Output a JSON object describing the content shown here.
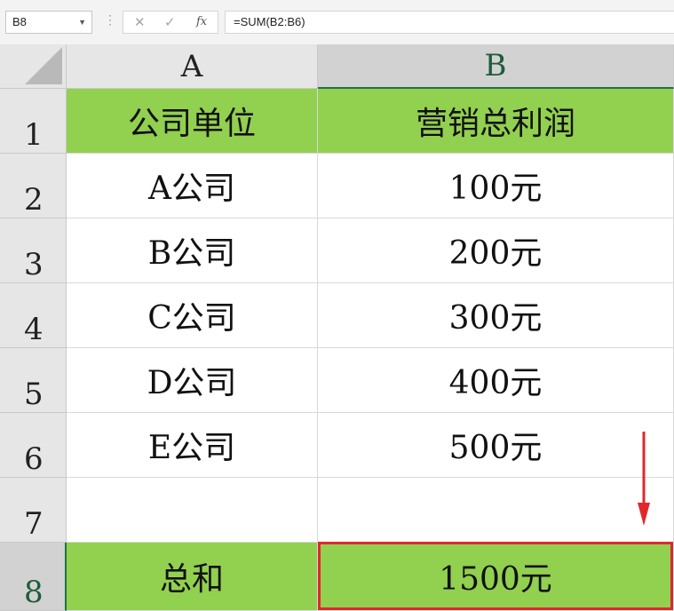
{
  "formula_bar": {
    "name_box": "B8",
    "cancel_icon": "✕",
    "enter_icon": "✓",
    "fx_label": "fx",
    "formula": "=SUM(B2:B6)"
  },
  "columns": [
    "A",
    "B"
  ],
  "rows": [
    "1",
    "2",
    "3",
    "4",
    "5",
    "6",
    "7",
    "8"
  ],
  "cells": {
    "A1": "公司单位",
    "B1": "营销总利润",
    "A2": "A公司",
    "B2": "100元",
    "A3": "B公司",
    "B3": "200元",
    "A4": "C公司",
    "B4": "300元",
    "A5": "D公司",
    "B5": "400元",
    "A6": "E公司",
    "B6": "500元",
    "A7": "",
    "B7": "",
    "A8": "总和",
    "B8": "1500元"
  },
  "colors": {
    "header_fill": "#92d050",
    "selection_highlight": "#e0282c",
    "arrow": "#e0282c",
    "selected_header_accent": "#217346"
  },
  "selected_cell": "B8"
}
